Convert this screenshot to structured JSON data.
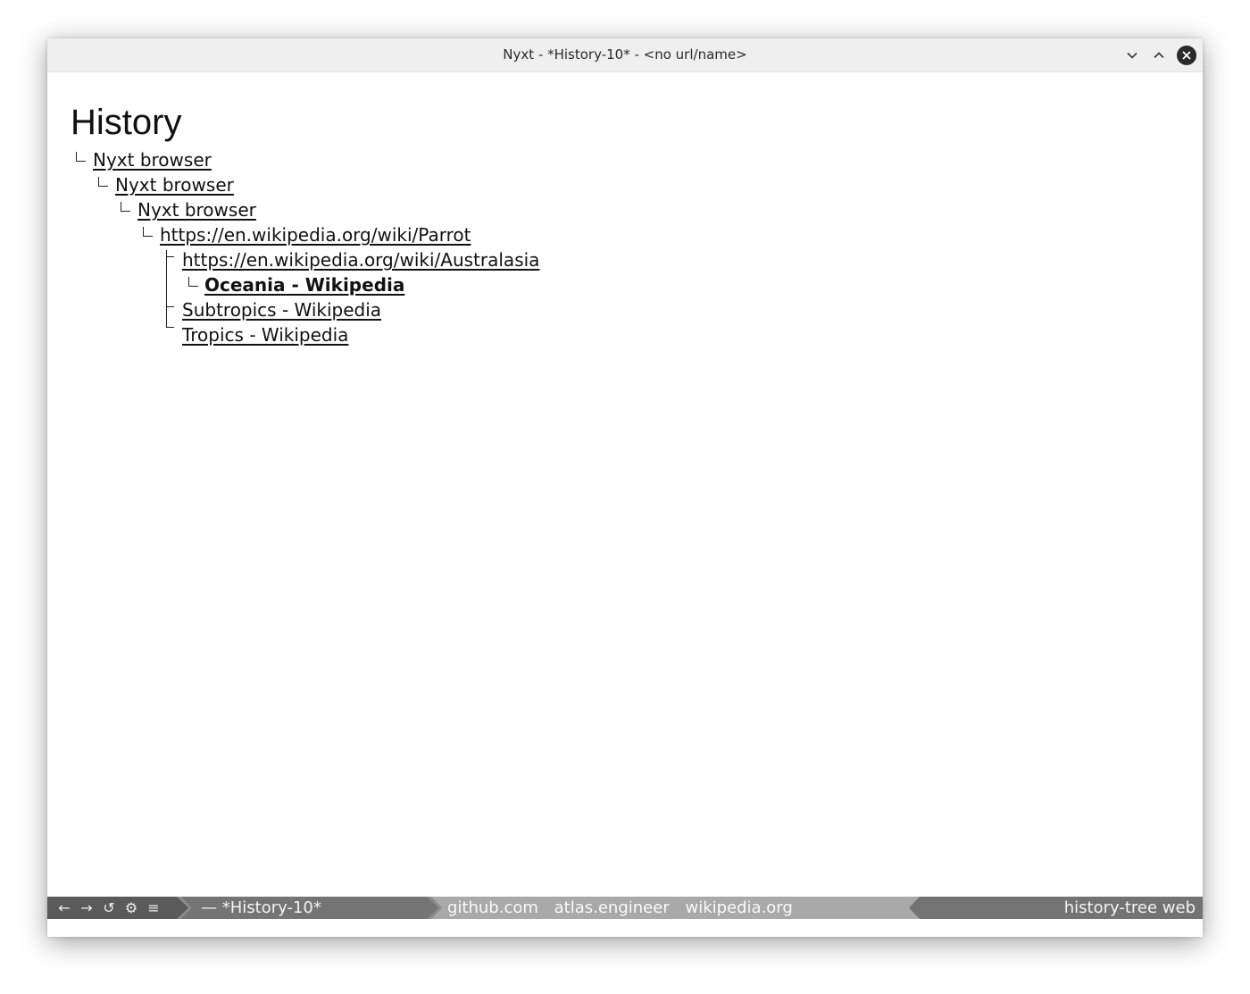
{
  "window": {
    "title": "Nyxt - *History-10* - <no url/name>"
  },
  "page": {
    "heading": "History"
  },
  "tree": [
    {
      "label": "Nyxt browser",
      "depth": 0
    },
    {
      "label": "Nyxt browser",
      "depth": 1
    },
    {
      "label": "Nyxt browser",
      "depth": 2
    },
    {
      "label": "https://en.wikipedia.org/wiki/Parrot",
      "depth": 3
    },
    {
      "label": "https://en.wikipedia.org/wiki/Australasia",
      "depth": 4
    },
    {
      "label": "Oceania - Wikipedia",
      "depth": 5,
      "current": true
    },
    {
      "label": "Subtropics - Wikipedia",
      "depth": 4
    },
    {
      "label": "Tropics - Wikipedia",
      "depth": 4
    }
  ],
  "statusbar": {
    "nav_icons": [
      "back-icon",
      "forward-icon",
      "reload-icon",
      "settings-icon",
      "menu-icon"
    ],
    "nav_glyphs": [
      "←",
      "→",
      "↺",
      "⚙",
      "≡"
    ],
    "buffer": "— *History-10*",
    "domains": [
      "github.com",
      "atlas.engineer",
      "wikipedia.org"
    ],
    "modes": "history-tree web"
  }
}
